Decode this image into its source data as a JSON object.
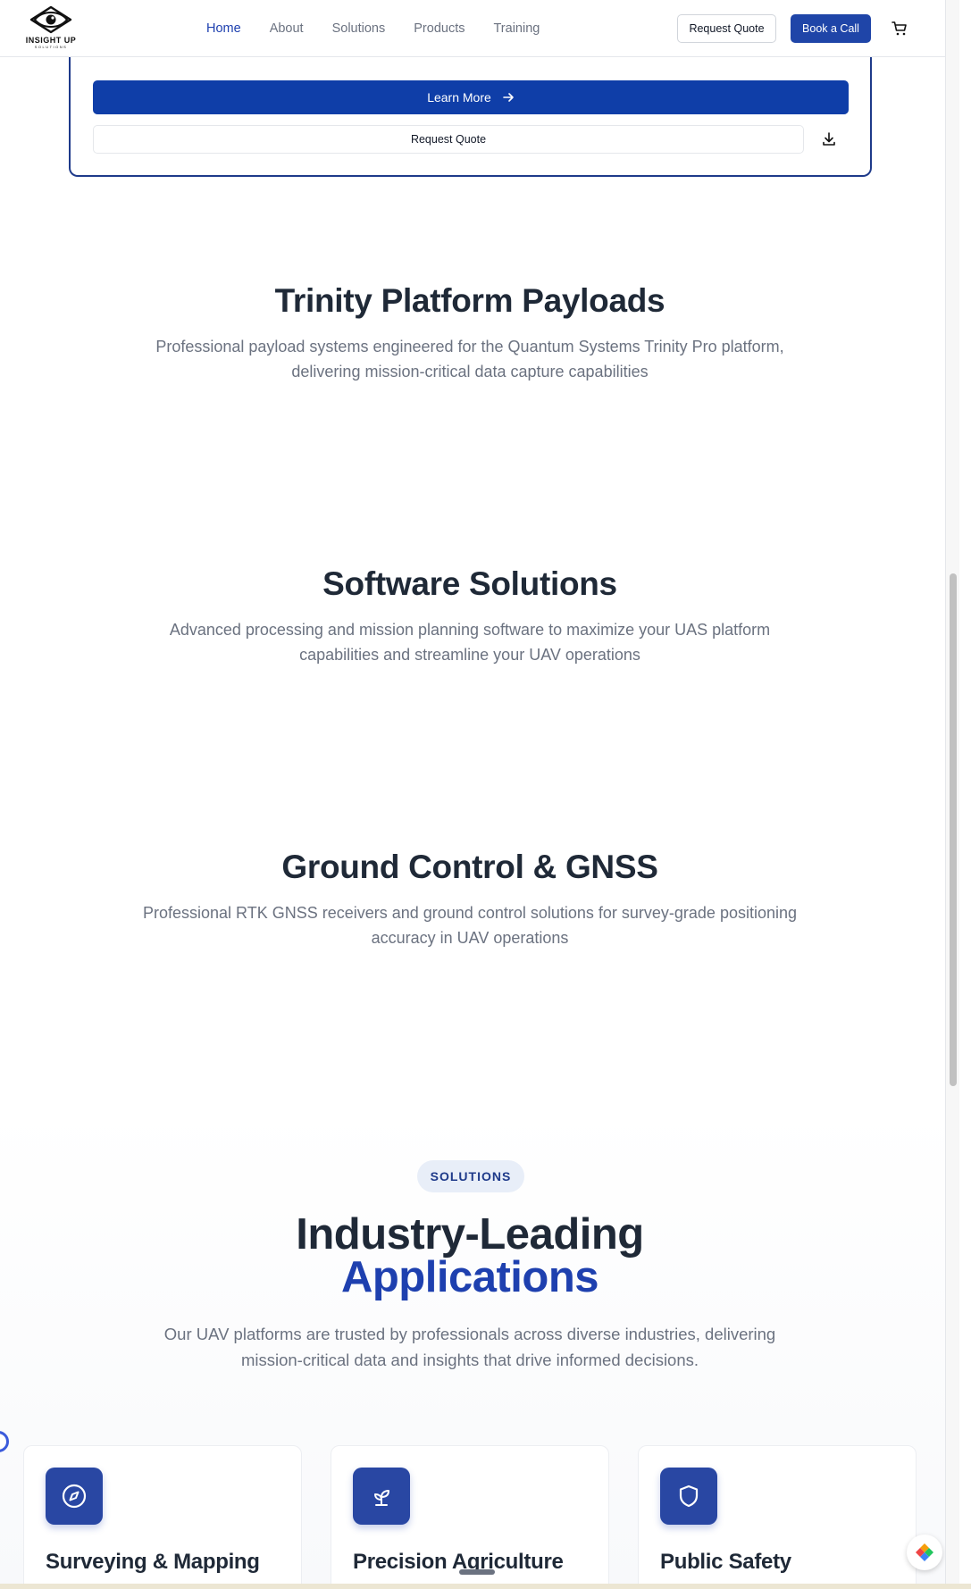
{
  "header": {
    "logo_text": "INSIGHT UP",
    "logo_subtext": "SOLUTIONS",
    "nav": [
      "Home",
      "About",
      "Solutions",
      "Products",
      "Training"
    ],
    "active_nav": "Home",
    "request_quote": "Request Quote",
    "book_call": "Book a Call"
  },
  "top_card": {
    "learn_more": "Learn More",
    "request_quote": "Request Quote"
  },
  "sections": [
    {
      "title": "Trinity Platform Payloads",
      "desc_line1": "Professional payload systems engineered for the Quantum Systems Trinity Pro platform,",
      "desc_line2": "delivering mission-critical data capture capabilities"
    },
    {
      "title": "Software Solutions",
      "desc_line1": "Advanced processing and mission planning software to maximize your UAS platform",
      "desc_line2": "capabilities and streamline your UAV operations"
    },
    {
      "title": "Ground Control & GNSS",
      "desc_line1": "Professional RTK GNSS receivers and ground control solutions for survey-grade positioning",
      "desc_line2": "accuracy in UAV operations"
    }
  ],
  "applications": {
    "badge": "SOLUTIONS",
    "title_line1": "Industry-Leading",
    "title_line2": "Applications",
    "desc_line1": "Our UAV platforms are trusted by professionals across diverse industries, delivering",
    "desc_line2": "mission-critical data and insights that drive informed decisions.",
    "cards": [
      {
        "title": "Surveying & Mapping",
        "icon": "compass-icon"
      },
      {
        "title": "Precision Agriculture",
        "icon": "sprout-icon"
      },
      {
        "title": "Public Safety",
        "icon": "shield-icon"
      }
    ]
  },
  "colors": {
    "brand_blue": "#1e40af",
    "button_blue": "#0f3ea8",
    "icon_tile": "#2947a3",
    "text_dark": "#1f2937",
    "text_muted": "#6b7280"
  }
}
